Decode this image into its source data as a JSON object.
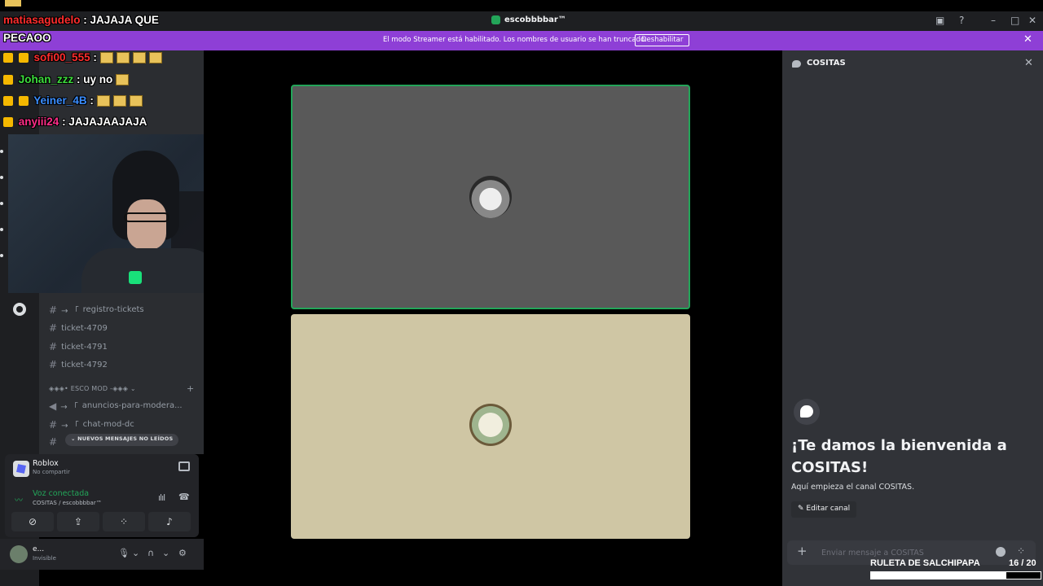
{
  "titlebar": {
    "server_name": "escobbbbar™"
  },
  "banner": {
    "message": "El modo Streamer está habilitado. Los nombres de usuario se han truncado.",
    "button": "Deshabilitar"
  },
  "channels": [
    {
      "name": "registro-tickets",
      "prefix": "→ 「"
    },
    {
      "name": "ticket-4709",
      "prefix": ""
    },
    {
      "name": "ticket-4791",
      "prefix": ""
    },
    {
      "name": "ticket-4792",
      "prefix": ""
    },
    {
      "name": "anuncios-para-modera...",
      "prefix": "→ 「"
    },
    {
      "name": "chat-mod-dc",
      "prefix": "→ 「"
    }
  ],
  "category": "◈◈◈• ESCO MOD -◈◈◈ ⌄",
  "new_messages_pill": "⌄  NUEVOS MENSAJES NO LEÍDOS",
  "activity": {
    "title": "Roblox",
    "subtitle": "No compartir"
  },
  "voice": {
    "status": "Voz conectada",
    "channel": "COSITAS / escobbbbar™"
  },
  "user": {
    "name": "e...",
    "status": "Invisible"
  },
  "chat_overlay": [
    {
      "user": "matiasagudelo",
      "text": ": JAJAJA QUE"
    },
    {
      "user": "PECAOO",
      "text": ""
    },
    {
      "user": "sofi00_555",
      "text": ":"
    },
    {
      "user": "Johan_zzz",
      "text": ": uy no"
    },
    {
      "user": "Yeiner_4B",
      "text": ":"
    },
    {
      "user": "anyiii24",
      "text": ": JAJAJAAJAJA"
    }
  ],
  "text_channel": {
    "name": "COSITAS",
    "welcome": "¡Te damos la bienvenida a COSITAS!",
    "subtitle": "Aquí empieza el canal COSITAS.",
    "edit_button": "Editar canal",
    "input_placeholder": "Enviar mensaje a COSITAS"
  },
  "ruleta": {
    "label": "RULETA DE SALCHIPAPA",
    "count": "16  / 20",
    "progress": 0.8
  },
  "colors": {
    "accent_green": "#23a559",
    "banner_purple": "#8e3fd6"
  }
}
